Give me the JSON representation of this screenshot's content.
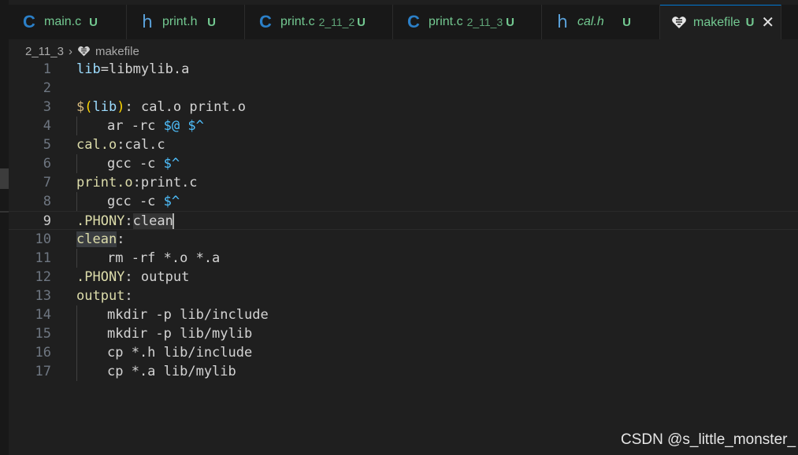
{
  "tabs": [
    {
      "icon": "C",
      "name": "main.c",
      "desc": "",
      "status": "U"
    },
    {
      "icon": "h",
      "name": "print.h",
      "desc": "",
      "status": "U"
    },
    {
      "icon": "C",
      "name": "print.c",
      "desc": "2_11_2",
      "status": "U"
    },
    {
      "icon": "C",
      "name": "print.c",
      "desc": "2_11_3",
      "status": "U"
    },
    {
      "icon": "h",
      "name": "cal.h",
      "desc": "",
      "status": "U"
    },
    {
      "icon": "makefile-icon",
      "name": "makefile",
      "desc": "",
      "status": "U",
      "close": "✕"
    }
  ],
  "breadcrumb": {
    "folder": "2_11_3",
    "separator": "›",
    "file": "makefile"
  },
  "editor": {
    "lines": [
      "1",
      "2",
      "3",
      "4",
      "5",
      "6",
      "7",
      "8",
      "9",
      "10",
      "11",
      "12",
      "13",
      "14",
      "15",
      "16",
      "17"
    ],
    "code": {
      "l1": {
        "a": "lib",
        "b": "=libmylib.a"
      },
      "l3": {
        "a": "$",
        "b": "(",
        "c": "lib",
        "d": ")",
        "e": ":",
        "f": " cal.o print.o"
      },
      "l4": {
        "a": "ar -rc ",
        "b": "$@",
        "c": " ",
        "d": "$^"
      },
      "l5": {
        "a": "cal.o",
        "b": ":cal.c"
      },
      "l6": {
        "a": "gcc -c ",
        "b": "$^"
      },
      "l7": {
        "a": "print.o",
        "b": ":print.c"
      },
      "l8": {
        "a": "gcc -c ",
        "b": "$^"
      },
      "l9": {
        "a": ".PHONY",
        ":": ":",
        "b": "clean"
      },
      "l10": {
        "a": "clean",
        "b": ":"
      },
      "l11": {
        "a": "rm -rf *.o *.a"
      },
      "l12": {
        "a": ".PHONY",
        "b": ":",
        "c": " output"
      },
      "l13": {
        "a": "output",
        "b": ":"
      },
      "l14": {
        "a": "mkdir -p lib/include"
      },
      "l15": {
        "a": "mkdir -p lib/mylib"
      },
      "l16": {
        "a": "cp *.h lib/include"
      },
      "l17": {
        "a": "cp *.a lib/mylib"
      }
    }
  },
  "watermark": "CSDN @s_little_monster_"
}
